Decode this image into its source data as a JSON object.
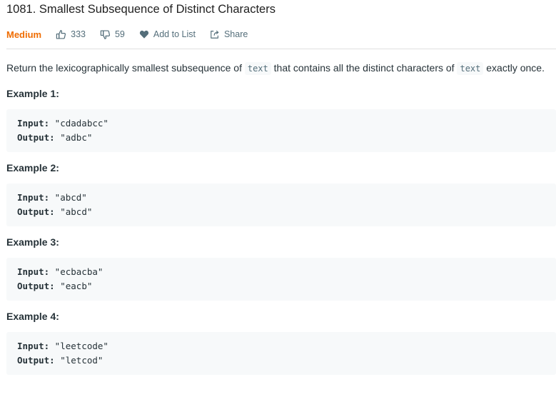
{
  "problem": {
    "title": "1081. Smallest Subsequence of Distinct Characters",
    "difficulty": "Medium",
    "likes": "333",
    "dislikes": "59",
    "add_to_list_label": "Add to List",
    "share_label": "Share"
  },
  "description": {
    "part1": "Return the lexicographically smallest subsequence of ",
    "code1": "text",
    "part2": " that contains all the distinct characters of ",
    "code2": "text",
    "part3": " exactly once."
  },
  "examples": [
    {
      "title": "Example 1:",
      "input_label": "Input:",
      "input": " \"cdadabcc\"",
      "output_label": "Output:",
      "output": " \"adbc\""
    },
    {
      "title": "Example 2:",
      "input_label": "Input:",
      "input": " \"abcd\"",
      "output_label": "Output:",
      "output": " \"abcd\""
    },
    {
      "title": "Example 3:",
      "input_label": "Input:",
      "input": " \"ecbacba\"",
      "output_label": "Output:",
      "output": " \"eacb\""
    },
    {
      "title": "Example 4:",
      "input_label": "Input:",
      "input": " \"leetcode\"",
      "output_label": "Output:",
      "output": " \"letcod\""
    }
  ],
  "colors": {
    "difficulty_medium": "#ef6c00",
    "text": "#263238",
    "muted": "#546e7a",
    "code_bg": "#f7f9fa"
  },
  "icons": {
    "like": "thumbs-up-icon",
    "dislike": "thumbs-down-icon",
    "add_to_list": "heart-icon",
    "share": "share-icon"
  }
}
